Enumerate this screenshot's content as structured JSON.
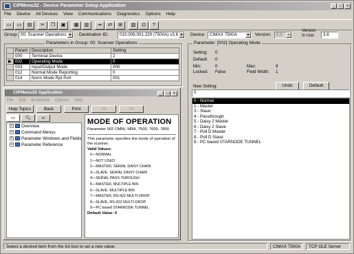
{
  "title": "CIPMenu32 - Device Parameter Setup Application",
  "window_controls": {
    "min": "_",
    "max": "□",
    "close": "×"
  },
  "menu": [
    "File",
    "Device",
    "All Devices",
    "View",
    "Communications",
    "Diagnostics",
    "Options",
    "Help"
  ],
  "toolbar_icons": [
    "open-icon",
    "save-icon",
    "print-icon",
    "cut-icon",
    "copy-icon",
    "paste-icon",
    "download-icon",
    "upload-icon",
    "connect-icon",
    "disconnect-icon",
    "compare-icon",
    "settings-icon",
    "refresh-icon",
    "help-icon"
  ],
  "selectors": {
    "group_label": "Group:",
    "group_value": "00: Scanner Operations",
    "destination_label": "Destination ID:",
    "destination_value": "010.006.001.220 (7500A) v3.6",
    "device_label": "Device:",
    "device_value": "CIMAX 7500A",
    "version_label": "Version:",
    "version_value": "3.6",
    "version_inuse_label_1": "Version",
    "version_inuse_label_2": "In Use:",
    "version_inuse_value": "3.6"
  },
  "param_table": {
    "group_title": "Parameters in Group: 00: Scanner Operations",
    "headers": [
      "Param",
      "Description",
      "Setting"
    ],
    "rows": [
      {
        "marker": "",
        "param": "000",
        "description": "Terminal Device",
        "setting": "2"
      },
      {
        "marker": "▶",
        "param": "002",
        "description": "Operating Mode",
        "setting": "0"
      },
      {
        "marker": "",
        "param": "003",
        "description": "Input/Output Mode",
        "setting": "000"
      },
      {
        "marker": "",
        "param": "012",
        "description": "Normal Mode Reporting",
        "setting": "0"
      },
      {
        "marker": "",
        "param": "014",
        "description": "Norm Mode Rpt Port",
        "setting": "001"
      }
    ]
  },
  "param_detail": {
    "group_title": "Parameter: [002] Operating Mode",
    "setting_label": "Setting:",
    "setting_value": "0",
    "default_label": "Default:",
    "default_value": "0",
    "min_label": "Min:",
    "min_value": "0",
    "max_label": "Max:",
    "max_value": "9",
    "locked_label": "Locked:",
    "locked_value": "False",
    "field_width_label": "Field Width:",
    "field_width_value": "1",
    "new_setting_label": "New Setting:",
    "new_setting_value": "0",
    "undo_label": "Undo",
    "default_btn_label": "Default",
    "options": [
      "0 - Normal",
      "1 - Master",
      "3 - Slave",
      "4 - Passthrough",
      "5 - Daisy 2 Master",
      "6 - Daisy 2 Slave",
      "7 - Poll D Master",
      "8 - Poll D Slave",
      "9 - PC based STARNODE TUNNEL"
    ],
    "selected_index": 0
  },
  "help": {
    "title": "CIPMenu32 Application",
    "menu": [
      "File",
      "Edit",
      "Bookmark",
      "Options",
      "Help"
    ],
    "buttons": [
      "Help Topics",
      "Back",
      "Print",
      "<<",
      ">>"
    ],
    "tab_icons": [
      "contents-book-icon",
      "index-magnifier-icon",
      "find-binoculars-icon"
    ],
    "tree": [
      "Overview",
      "Command Menus",
      "Parameter Windows and Fields",
      "Parameter Reference"
    ],
    "heading": "MODE OF OPERATION",
    "param_line": "Parameter 002     OMNI, MINI, 7500, 7600, 7800",
    "description": "This parameter specifies the mode of operation of the scanner.",
    "valid_values_label": "Valid Values:",
    "values": [
      "0—NORMAL",
      "1—NOT USED",
      "2—MASTER, SERIAL DAISY CHAIN",
      "3—SLAVE, SERIAL DAISY CHAIN",
      "4—SERIAL PASS-THROUGH",
      "5—MASTER, MULTIPLE BIN",
      "6—SLAVE, MULTIPLE BIN",
      "7—MASTER, RS-422 MULTI-DROP",
      "8—SLAVE, RS-422 MULTI-DROP",
      "9—PC based STARNODE TUNNEL"
    ],
    "default_line": "Default Value: 0"
  },
  "status": {
    "message": "Select a desired item from the list box to set a new value.",
    "device": "CIMAX 7500A",
    "server": "TCP OLE Server"
  }
}
